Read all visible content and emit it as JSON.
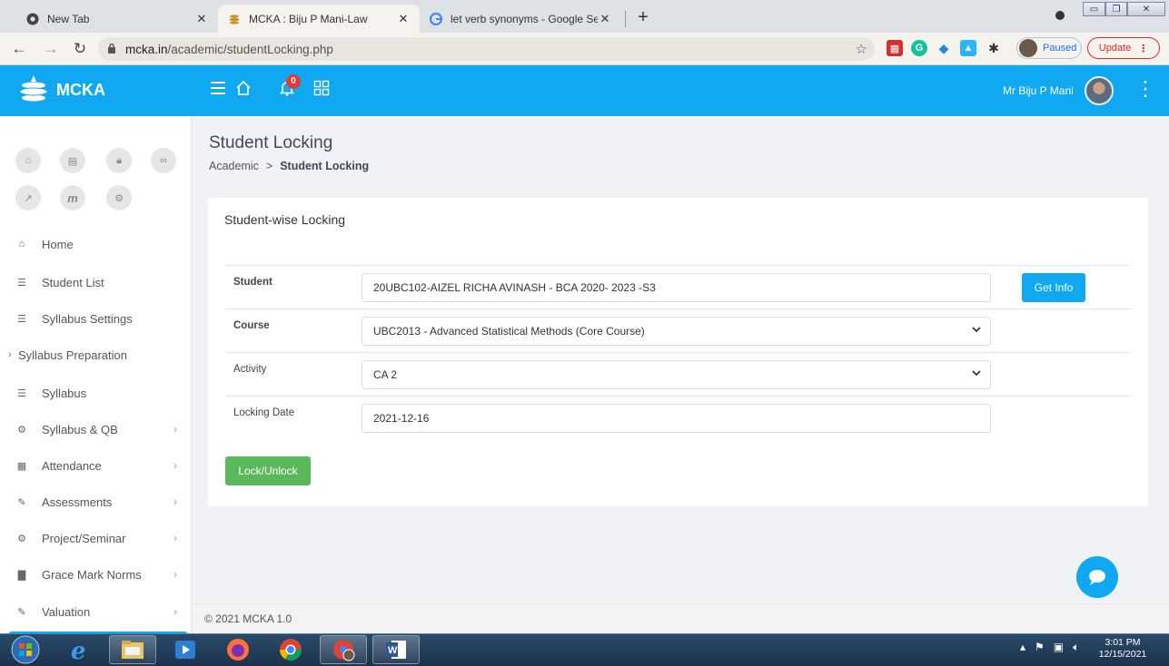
{
  "browser": {
    "tabs": [
      {
        "label": "New Tab",
        "icon": "chrome-icon",
        "active": false
      },
      {
        "label": "MCKA : Biju P Mani-Law",
        "icon": "mcka-favicon",
        "active": true
      },
      {
        "label": "let verb synonyms - Google Sear",
        "icon": "google-icon",
        "active": false
      }
    ],
    "url_host": "mcka.in",
    "url_path": "/academic/studentLocking.php",
    "paused_label": "Paused",
    "update_label": "Update"
  },
  "app": {
    "brand": "MCKA",
    "notification_count": "0",
    "user_name": "Mr Biju P Mani",
    "accent_color": "#10a9f1"
  },
  "sidebar": {
    "quick_actions": [
      "home-icon",
      "id-card-icon",
      "lock-icon",
      "handshake-icon",
      "external-link-icon",
      "moodle-icon",
      "gear-icon"
    ],
    "items": [
      {
        "label": "Home",
        "icon": "home-icon",
        "chevron": false
      },
      {
        "label": "Student List",
        "icon": "list-icon",
        "chevron": false
      },
      {
        "label": "Syllabus Settings",
        "icon": "list-icon",
        "chevron": false
      },
      {
        "label": "Syllabus Preparation",
        "icon": "chevron-right-icon",
        "chevron": false
      },
      {
        "label": "Syllabus",
        "icon": "list-icon",
        "chevron": false
      },
      {
        "label": "Syllabus & QB",
        "icon": "cogs-icon",
        "chevron": true
      },
      {
        "label": "Attendance",
        "icon": "calendar-icon",
        "chevron": true
      },
      {
        "label": "Assessments",
        "icon": "pencil-icon",
        "chevron": true
      },
      {
        "label": "Project/Seminar",
        "icon": "cogs-icon",
        "chevron": true
      },
      {
        "label": "Grace Mark Norms",
        "icon": "book-icon",
        "chevron": true
      },
      {
        "label": "Valuation",
        "icon": "pencil-icon",
        "chevron": true
      }
    ]
  },
  "page": {
    "title": "Student Locking",
    "breadcrumb": {
      "parent": "Academic",
      "current": "Student Locking"
    }
  },
  "form": {
    "card_title": "Student-wise Locking",
    "student_label": "Student",
    "student_value": "20UBC102-AIZEL RICHA AVINASH - BCA 2020- 2023 -S3",
    "get_info_label": "Get Info",
    "course_label": "Course",
    "course_value": "UBC2013 - Advanced Statistical Methods (Core Course)",
    "activity_label": "Activity",
    "activity_value": "CA 2",
    "locking_date_label": "Locking Date",
    "locking_date_value": "2021-12-16",
    "submit_label": "Lock/Unlock"
  },
  "footer": {
    "text": "© 2021 MCKA 1.0"
  },
  "taskbar": {
    "apps": [
      "windows-start-icon",
      "internet-explorer-icon",
      "file-explorer-icon",
      "media-player-icon",
      "firefox-icon",
      "chrome-icon",
      "chrome-profile-icon",
      "word-icon"
    ],
    "clock_time": "3:01 PM",
    "clock_date": "12/15/2021"
  }
}
